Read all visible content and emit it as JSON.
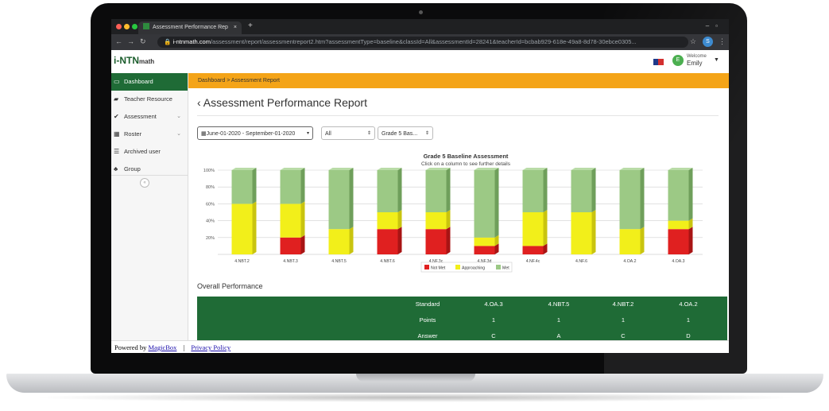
{
  "browser": {
    "tab_title": "Assessment Performance Rep",
    "tab_close": "×",
    "new_tab": "+",
    "url_host": "i-ntnmath.com",
    "url_rest": "/assessment/report/assessmentreport2.htm?assessmentType=baseline&classId=All&assessmentId=28241&teacherId=bcbab929-618e-49a8-8d78-30ebce0305...",
    "profile_initial": "S"
  },
  "header": {
    "logo_text": "i-NTN",
    "logo_suffix": "math",
    "welcome": "Welcome",
    "user_name": "Emily",
    "avatar_initial": "E"
  },
  "sidebar": {
    "items": [
      {
        "label": "Dashboard",
        "icon": "monitor-icon"
      },
      {
        "label": "Teacher Resource",
        "icon": "folder-icon"
      },
      {
        "label": "Assessment",
        "icon": "check-icon"
      },
      {
        "label": "Roster",
        "icon": "calendar-icon"
      },
      {
        "label": "Archived user",
        "icon": "list-icon"
      },
      {
        "label": "Group",
        "icon": "group-icon"
      }
    ],
    "collapse_glyph": "«"
  },
  "breadcrumb": "Dashboard > Assessment Report",
  "page_title": "Assessment Performance Report",
  "filters": {
    "date_range": "June-01-2020 - September-01-2020",
    "class": "All",
    "assessment": "Grade 5 Bas..."
  },
  "chart_data": {
    "type": "bar",
    "stacked": true,
    "title": "Grade 5 Baseline Assessment",
    "subtitle": "Click on a column to see further details",
    "categories": [
      "4.NBT.2",
      "4.NBT.3",
      "4.NBT.5",
      "4.NBT.6",
      "4.NF.3c",
      "4.NF.3d",
      "4.NF.4c",
      "4.NF.6",
      "4.OA.2",
      "4.OA.3"
    ],
    "y_ticks": [
      "100%",
      "80%",
      "60%",
      "40%",
      "20%"
    ],
    "ylim": [
      0,
      100
    ],
    "series": [
      {
        "name": "Not Met",
        "color": "#e02020",
        "values": [
          0,
          20,
          0,
          30,
          30,
          10,
          10,
          0,
          0,
          30
        ]
      },
      {
        "name": "Approaching",
        "color": "#f2ef1a",
        "values": [
          60,
          40,
          30,
          20,
          20,
          10,
          40,
          50,
          30,
          10
        ]
      },
      {
        "name": "Met",
        "color": "#9cc985",
        "values": [
          40,
          40,
          70,
          50,
          50,
          80,
          50,
          50,
          70,
          60
        ]
      }
    ],
    "legend_position": "bottom-center"
  },
  "overall": {
    "title": "Overall Performance",
    "rows": [
      {
        "label": "Standard",
        "values": [
          "4.OA.3",
          "4.NBT.5",
          "4.NBT.2",
          "4.OA.2"
        ]
      },
      {
        "label": "Points",
        "values": [
          "1",
          "1",
          "1",
          "1"
        ]
      },
      {
        "label": "Answer",
        "values": [
          "C",
          "A",
          "C",
          "D"
        ]
      }
    ]
  },
  "footer": {
    "powered_by": "Powered by",
    "powered_link": "MagicBox",
    "separator": "|",
    "privacy": "Privacy Policy"
  }
}
